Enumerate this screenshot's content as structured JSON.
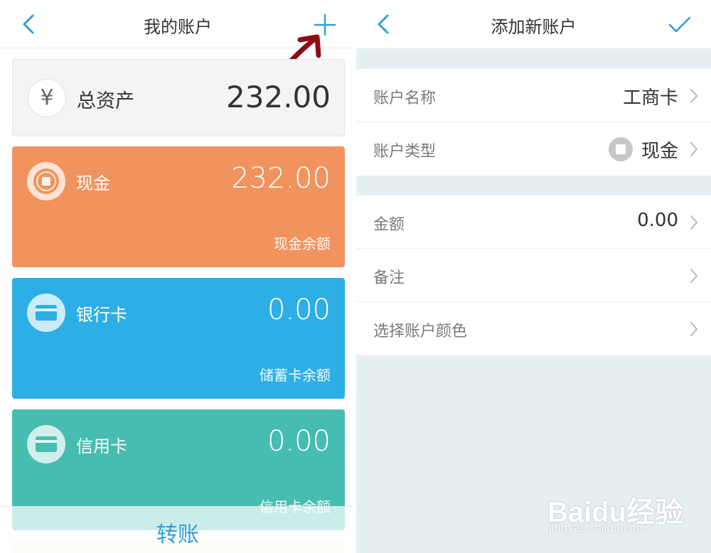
{
  "left": {
    "title": "我的账户",
    "total": {
      "icon": "yen-icon",
      "symbol": "¥",
      "label": "总资产",
      "amount": "232.00"
    },
    "cards": [
      {
        "name": "现金",
        "amount": "232.00",
        "subtitle": "现金余额",
        "color": "#f0935e",
        "icon": "cash-coin-icon"
      },
      {
        "name": "银行卡",
        "amount": "0.00",
        "subtitle": "储蓄卡余额",
        "color": "#2eaee6",
        "icon": "bank-card-icon"
      },
      {
        "name": "信用卡",
        "amount": "0.00",
        "subtitle": "信用卡余额",
        "color": "#46bdb0",
        "icon": "credit-card-icon"
      }
    ],
    "transfer_label": "转账",
    "annotation_color": "#8c0c14"
  },
  "right": {
    "title": "添加新账户",
    "rows": [
      {
        "label": "账户名称",
        "value": "工商卡"
      },
      {
        "label": "账户类型",
        "value": "现金"
      },
      {
        "label": "金额",
        "value": "0.00"
      },
      {
        "label": "备注",
        "value": ""
      },
      {
        "label": "选择账户颜色",
        "value": ""
      }
    ],
    "accent_color": "#2f9fd4"
  },
  "watermark": {
    "brand": "Baidu经验",
    "url": "jingyan.baidu.com"
  }
}
